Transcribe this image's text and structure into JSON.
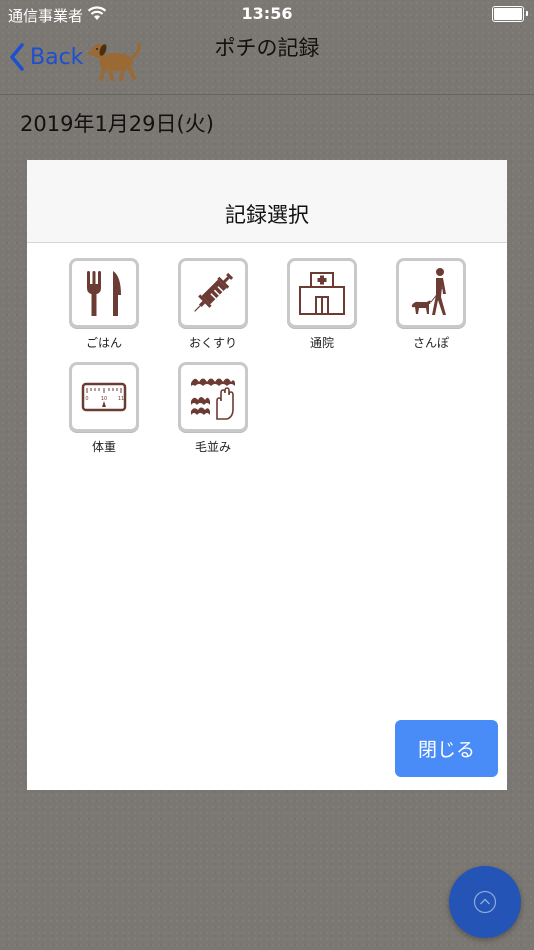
{
  "status_bar": {
    "carrier": "通信事業者",
    "time": "13:56"
  },
  "nav": {
    "back_label": "Back",
    "title": "ポチの記録"
  },
  "date": "2019年1月29日(火)",
  "modal": {
    "title": "記録選択",
    "items": [
      {
        "label": "ごはん",
        "icon": "fork-knife-icon"
      },
      {
        "label": "おくすり",
        "icon": "syringe-icon"
      },
      {
        "label": "通院",
        "icon": "hospital-icon"
      },
      {
        "label": "さんぽ",
        "icon": "dog-walk-icon"
      },
      {
        "label": "体重",
        "icon": "scale-icon"
      },
      {
        "label": "毛並み",
        "icon": "fur-brush-icon"
      }
    ],
    "close_label": "閉じる"
  },
  "colors": {
    "accent": "#4a8cf7",
    "icon_brown": "#6b3b34",
    "fab": "#2455b6",
    "back_link": "#1d4fd1"
  }
}
